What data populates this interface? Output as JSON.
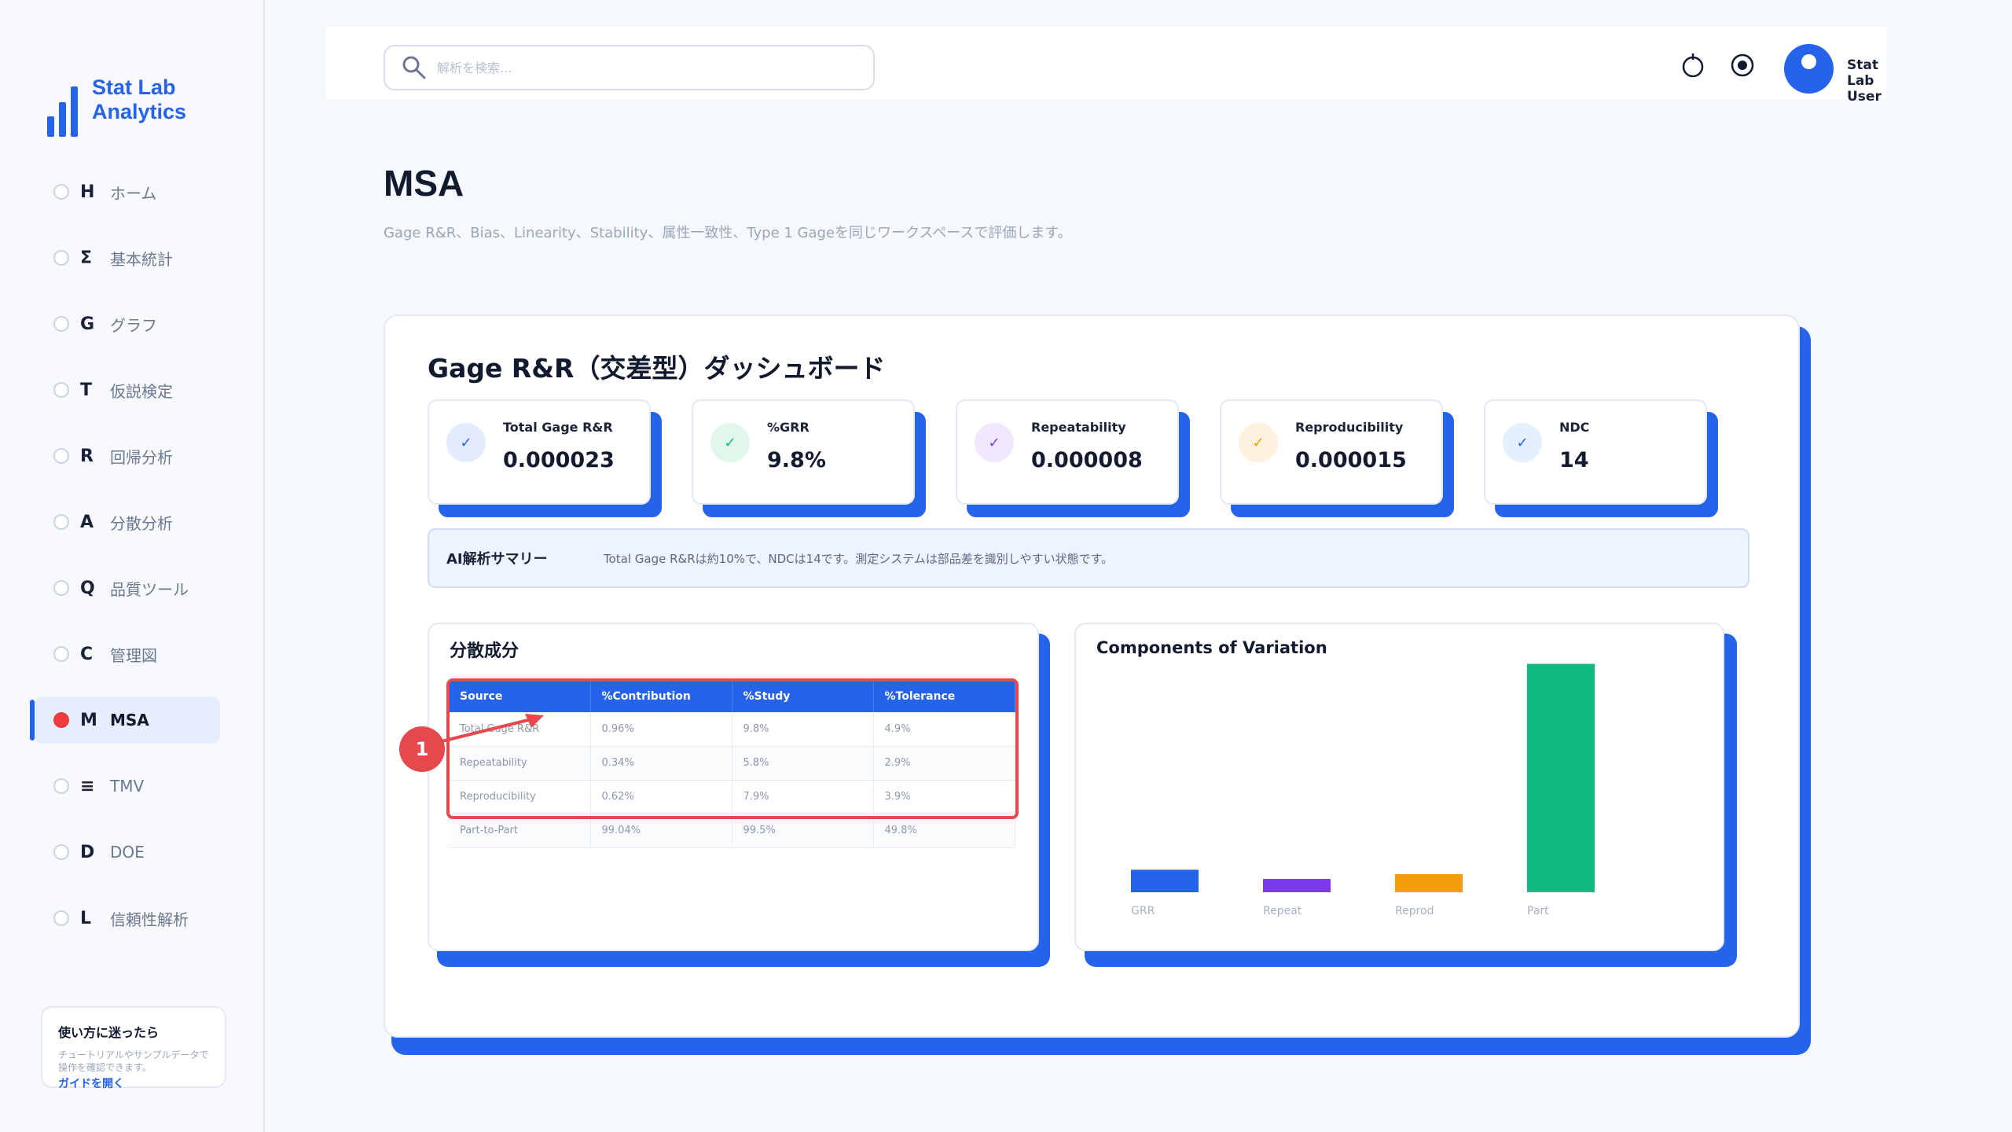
{
  "sidebar": {
    "brand": "Stat Lab Analytics",
    "items": [
      {
        "key": "H",
        "label": "ホーム"
      },
      {
        "key": "Σ",
        "label": "基本統計"
      },
      {
        "key": "G",
        "label": "グラフ"
      },
      {
        "key": "T",
        "label": "仮説検定"
      },
      {
        "key": "R",
        "label": "回帰分析"
      },
      {
        "key": "A",
        "label": "分散分析"
      },
      {
        "key": "Q",
        "label": "品質ツール"
      },
      {
        "key": "C",
        "label": "管理図"
      },
      {
        "key": "M",
        "label": "MSA",
        "active": true
      },
      {
        "key": "≡",
        "label": "TMV"
      },
      {
        "key": "D",
        "label": "DOE"
      },
      {
        "key": "L",
        "label": "信頼性解析"
      }
    ],
    "help": {
      "title": "使い方に迷ったら",
      "description": "チュートリアルやサンプルデータで操作を確認できます。",
      "link": "ガイドを開く"
    }
  },
  "topbar": {
    "search_placeholder": "解析を検索...",
    "user_name": "Stat Lab User"
  },
  "page": {
    "title": "MSA",
    "subtitle": "Gage R&R、Bias、Linearity、Stability、属性一致性、Type 1 Gageを同じワークスペースで評価します。"
  },
  "dashboard": {
    "title": "Gage R&R（交差型）ダッシュボード",
    "kpis": [
      {
        "label": "Total Gage R&R",
        "value": "0.000023",
        "icon_bg": "#e3ecff",
        "icon_color": "#2563eb"
      },
      {
        "label": "%GRR",
        "value": "9.8%",
        "icon_bg": "#e0f7ea",
        "icon_color": "#10b981"
      },
      {
        "label": "Repeatability",
        "value": "0.000008",
        "icon_bg": "#f1e8ff",
        "icon_color": "#7c3aed"
      },
      {
        "label": "Reproducibility",
        "value": "0.000015",
        "icon_bg": "#fff1dc",
        "icon_color": "#f59e0b"
      },
      {
        "label": "NDC",
        "value": "14",
        "icon_bg": "#e3f1ff",
        "icon_color": "#2563eb"
      }
    ],
    "kpi_check": "✓",
    "ai_summary": {
      "label": "AI解析サマリー",
      "text": "Total Gage R&Rは約10%で、NDCは14です。測定システムは部品差を識別しやすい状態です。"
    }
  },
  "variance_table": {
    "title": "分散成分",
    "headers": [
      "Source",
      "%Contribution",
      "%Study",
      "%Tolerance"
    ],
    "rows": [
      [
        "Total Gage R&R",
        "0.96%",
        "9.8%",
        "4.9%"
      ],
      [
        "Repeatability",
        "0.34%",
        "5.8%",
        "2.9%"
      ],
      [
        "Reproducibility",
        "0.62%",
        "7.9%",
        "3.9%"
      ],
      [
        "Part-to-Part",
        "99.04%",
        "99.5%",
        "49.8%"
      ]
    ],
    "callout_number": "1"
  },
  "chart_data": {
    "type": "bar",
    "title": "Components of Variation",
    "categories": [
      "GRR",
      "Repeat",
      "Reprod",
      "Part"
    ],
    "values": [
      9.8,
      5.8,
      7.9,
      99.5
    ],
    "colors": [
      "#2563eb",
      "#7c3aed",
      "#f59e0b",
      "#10b981"
    ],
    "xlabel": "",
    "ylabel": "",
    "ylim": [
      0,
      100
    ],
    "grid": false,
    "legend": "none"
  },
  "colors": {
    "accent": "#2563eb",
    "alert": "#e5484d"
  }
}
